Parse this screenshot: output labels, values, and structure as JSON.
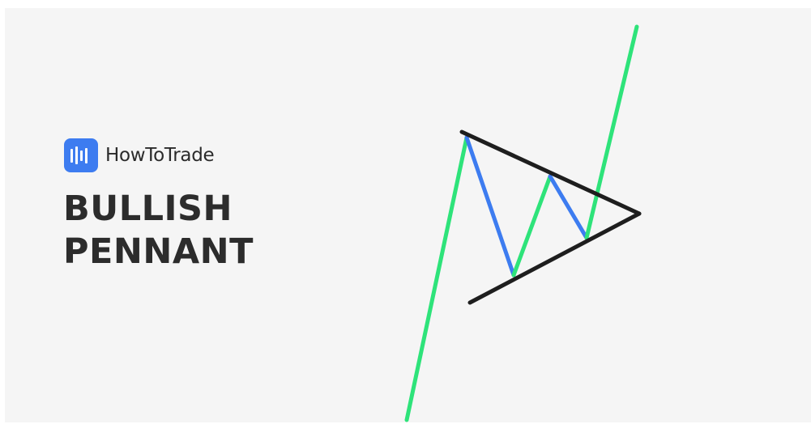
{
  "brand": {
    "name": "HowToTrade"
  },
  "heading": {
    "line1": "BULLISH",
    "line2": "PENNANT"
  },
  "colors": {
    "background": "#f5f5f5",
    "logo": "#3d7cf0",
    "up_leg": "#2ee37a",
    "down_leg": "#3d7cf0",
    "trendline": "#1e1e1e",
    "text": "#2c2c2c"
  },
  "diagram": {
    "type": "bullish-pennant",
    "legs": [
      {
        "direction": "up"
      },
      {
        "direction": "down"
      },
      {
        "direction": "up"
      },
      {
        "direction": "down"
      },
      {
        "direction": "up"
      }
    ]
  }
}
